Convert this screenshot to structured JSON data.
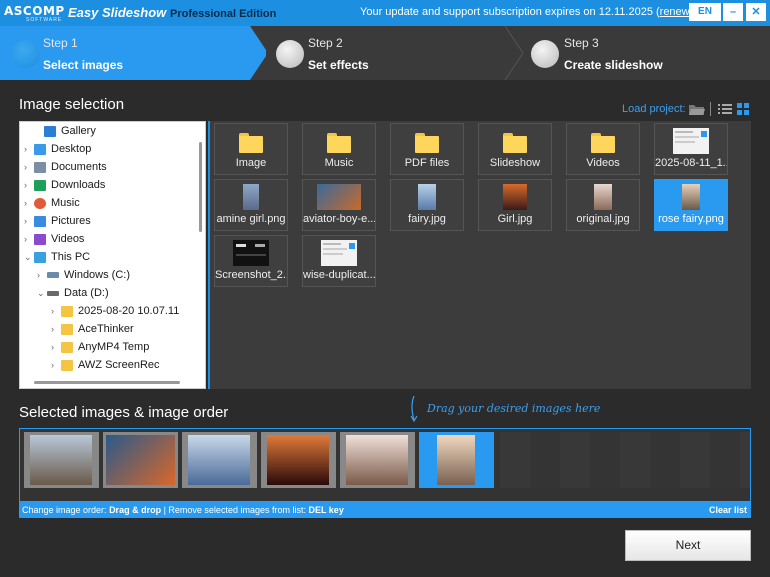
{
  "titlebar": {
    "logo": "ASCOMP",
    "logo_sub": "SOFTWARE",
    "app_name": "Easy Slideshow",
    "edition": "Professional Edition",
    "subscription_text": "Your update and support subscription expires on 12.11.2025 (",
    "renew_link": "renew now",
    "subscription_close": ")",
    "language": "EN",
    "minimize": "–",
    "close": "✕"
  },
  "steps": [
    {
      "num": "Step 1",
      "name": "Select images",
      "active": true
    },
    {
      "num": "Step 2",
      "name": "Set effects",
      "active": false
    },
    {
      "num": "Step 3",
      "name": "Create slideshow",
      "active": false
    }
  ],
  "image_selection": {
    "title": "Image selection",
    "load_project": "Load project:"
  },
  "tree": [
    {
      "label": "Gallery",
      "icon_color": "#2a7fd4",
      "icon": "gallery-icon"
    },
    {
      "label": "Desktop",
      "icon_color": "#3a9ae8",
      "icon": "desktop-icon"
    },
    {
      "label": "Documents",
      "icon_color": "#7a8fa6",
      "icon": "documents-icon"
    },
    {
      "label": "Downloads",
      "icon_color": "#1ea05a",
      "icon": "downloads-icon"
    },
    {
      "label": "Music",
      "icon_color": "#e05a3a",
      "icon": "music-icon"
    },
    {
      "label": "Pictures",
      "icon_color": "#3a8ae0",
      "icon": "pictures-icon"
    },
    {
      "label": "Videos",
      "icon_color": "#8a4ad0",
      "icon": "videos-icon"
    },
    {
      "label": "This PC",
      "icon_color": "#3aa0e0",
      "icon": "pc-icon"
    },
    {
      "label": "Windows (C:)",
      "icon_color": "#6a8aa8",
      "icon": "drive-icon"
    },
    {
      "label": "Data (D:)",
      "icon_color": "#6a6a6a",
      "icon": "drive-icon"
    },
    {
      "label": "2025-08-20 10.07.11",
      "icon_color": "#f4c542",
      "icon": "folder-icon"
    },
    {
      "label": "AceThinker",
      "icon_color": "#f4c542",
      "icon": "folder-icon"
    },
    {
      "label": "AnyMP4 Temp",
      "icon_color": "#f4c542",
      "icon": "folder-icon"
    },
    {
      "label": "AWZ ScreenRec",
      "icon_color": "#f4c542",
      "icon": "folder-icon"
    }
  ],
  "files": [
    {
      "label": "Image",
      "kind": "folder"
    },
    {
      "label": "Music",
      "kind": "folder"
    },
    {
      "label": "PDF files",
      "kind": "folder"
    },
    {
      "label": "Slideshow",
      "kind": "folder"
    },
    {
      "label": "Videos",
      "kind": "folder"
    },
    {
      "label": "2025-08-11_1...",
      "kind": "screenshot"
    },
    {
      "label": "amine girl.png",
      "kind": "image",
      "color": "#6a7fa8"
    },
    {
      "label": "aviator-boy-e...",
      "kind": "image",
      "color": "#b85a2a"
    },
    {
      "label": "fairy.jpg",
      "kind": "image",
      "color": "#7aa0c8"
    },
    {
      "label": "Girl.jpg",
      "kind": "image",
      "color": "#a84a2a"
    },
    {
      "label": "original.jpg",
      "kind": "image",
      "color": "#c8b0a8"
    },
    {
      "label": "rose fairy.png",
      "kind": "image",
      "color": "#c8a890",
      "selected": true
    },
    {
      "label": "Screenshot_2...",
      "kind": "dark"
    },
    {
      "label": "wise-duplicat...",
      "kind": "screenshot"
    }
  ],
  "selected": {
    "title": "Selected images & image order",
    "drag_hint": "Drag your desired images here",
    "items": [
      {
        "color": "#7a6a5a"
      },
      {
        "color": "#b85a2a"
      },
      {
        "color": "#6a90c0"
      },
      {
        "color": "#9a3a1a"
      },
      {
        "color": "#c8b8b0"
      },
      {
        "color": "#c8a890",
        "current": true
      }
    ],
    "info_change_label": "Change image order: ",
    "info_change_value": "Drag & drop",
    "info_sep": " | Remove selected images from list: ",
    "info_remove_value": "DEL key",
    "clear_list": "Clear list"
  },
  "next": "Next"
}
